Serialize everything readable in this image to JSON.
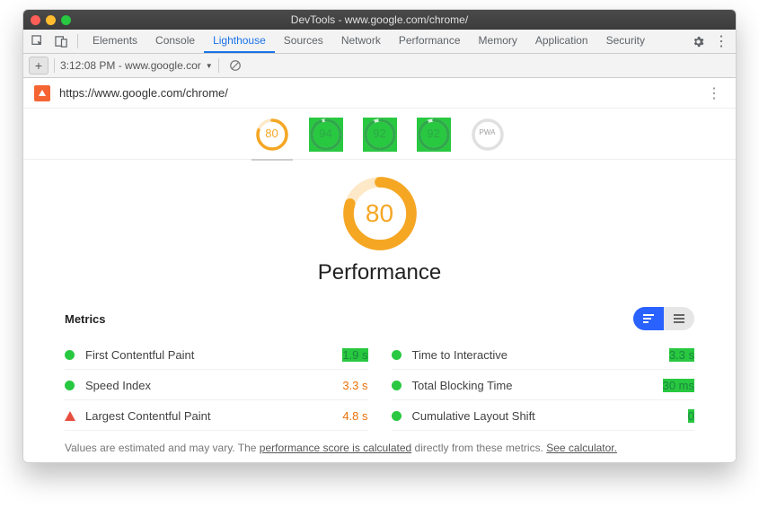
{
  "window": {
    "title": "DevTools - www.google.com/chrome/"
  },
  "tabs": {
    "items": [
      "Elements",
      "Console",
      "Lighthouse",
      "Sources",
      "Network",
      "Performance",
      "Memory",
      "Application",
      "Security"
    ],
    "active_index": 2
  },
  "toolbar": {
    "timestamp": "3:12:08 PM - www.google.cor",
    "dropdown_icon": "▼"
  },
  "urlbar": {
    "url": "https://www.google.com/chrome/"
  },
  "lighthouse": {
    "gauges": [
      {
        "score": "80",
        "color": "orange",
        "pct": 80,
        "selected": true
      },
      {
        "score": "94",
        "color": "green",
        "pct": 94,
        "selected": false
      },
      {
        "score": "92",
        "color": "green",
        "pct": 92,
        "selected": false
      },
      {
        "score": "92",
        "color": "green",
        "pct": 92,
        "selected": false
      },
      {
        "score": "PWA",
        "color": "grey",
        "pct": 0,
        "selected": false
      }
    ],
    "big": {
      "score": "80",
      "pct": 80,
      "title": "Performance"
    },
    "metrics_title": "Metrics",
    "metrics": [
      {
        "name": "First Contentful Paint",
        "value": "1.9 s",
        "status": "green",
        "val_color": "green"
      },
      {
        "name": "Time to Interactive",
        "value": "3.3 s",
        "status": "green",
        "val_color": "green"
      },
      {
        "name": "Speed Index",
        "value": "3.3 s",
        "status": "green",
        "val_color": "orange"
      },
      {
        "name": "Total Blocking Time",
        "value": "30 ms",
        "status": "green",
        "val_color": "green"
      },
      {
        "name": "Largest Contentful Paint",
        "value": "4.8 s",
        "status": "orange",
        "val_color": "orange"
      },
      {
        "name": "Cumulative Layout Shift",
        "value": "0",
        "status": "green",
        "val_color": "green"
      }
    ],
    "footnote": {
      "pre": "Values are estimated and may vary. The ",
      "u1": "performance score is calculated",
      "mid": " directly from these metrics. ",
      "u2": "See calculator."
    }
  }
}
